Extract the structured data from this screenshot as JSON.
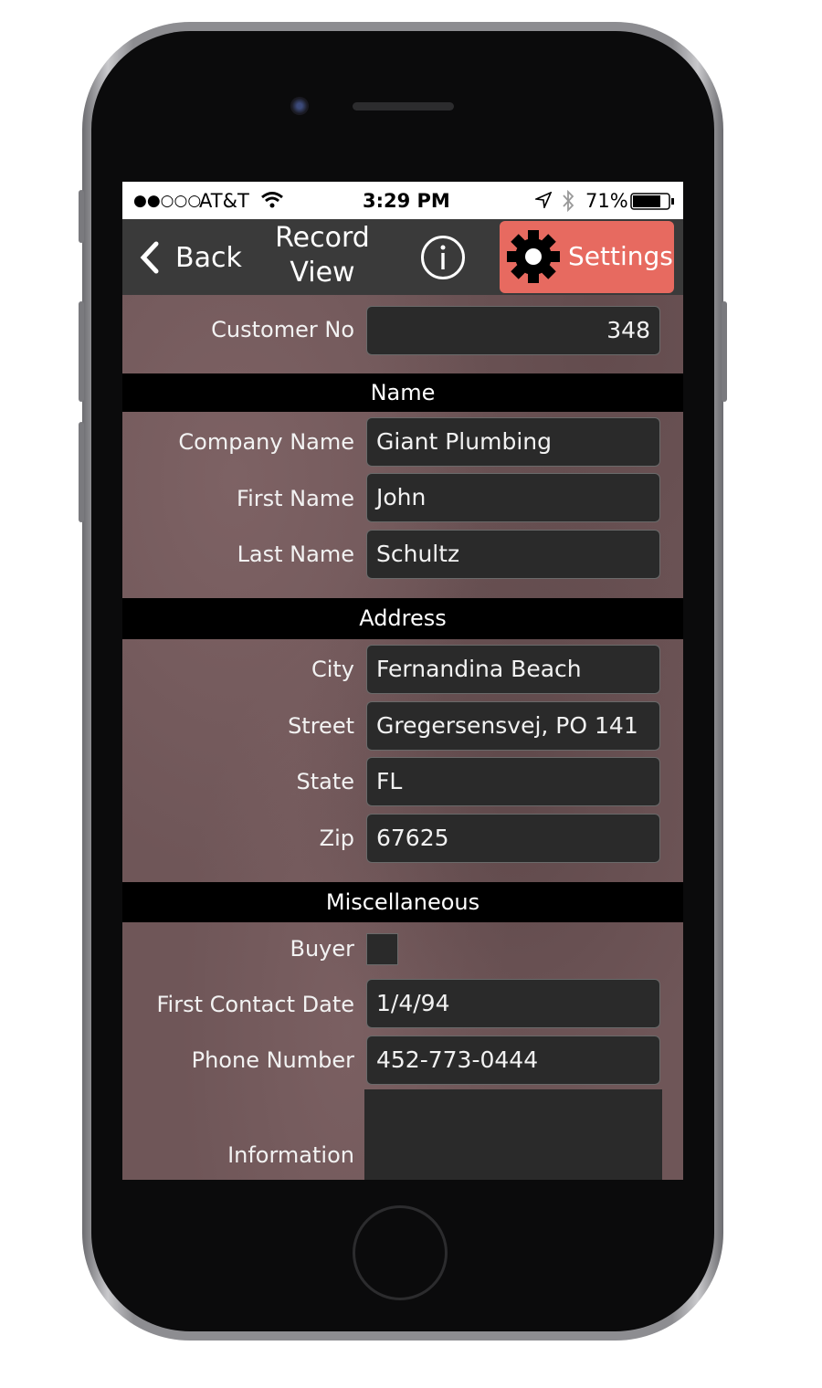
{
  "status_bar": {
    "signal": "●●○○○",
    "carrier": "AT&T",
    "time": "3:29 PM",
    "battery": "71%",
    "icons": [
      "wifi-icon",
      "location-icon",
      "bluetooth-icon",
      "battery-icon"
    ]
  },
  "nav": {
    "back_label": "Back",
    "title_line1": "Record",
    "title_line2": "View",
    "settings_label": "Settings",
    "settings_color": "#e76a60"
  },
  "fields": {
    "customer_no": {
      "label": "Customer No",
      "value": "348"
    },
    "name_header": "Name",
    "company_name": {
      "label": "Company Name",
      "value": "Giant Plumbing"
    },
    "first_name": {
      "label": "First Name",
      "value": "John"
    },
    "last_name": {
      "label": "Last Name",
      "value": "Schultz"
    },
    "address_header": "Address",
    "city": {
      "label": "City",
      "value": "Fernandina Beach"
    },
    "street": {
      "label": "Street",
      "value": "Gregersensvej, PO 141"
    },
    "state": {
      "label": "State",
      "value": "FL"
    },
    "zip": {
      "label": "Zip",
      "value": "67625"
    },
    "misc_header": "Miscellaneous",
    "buyer": {
      "label": "Buyer",
      "checked": false
    },
    "first_contact_date": {
      "label": "First Contact Date",
      "value": "1/4/94"
    },
    "phone_number": {
      "label": "Phone Number",
      "value": "452-773-0444"
    },
    "information": {
      "label": "Information",
      "value": ""
    }
  }
}
